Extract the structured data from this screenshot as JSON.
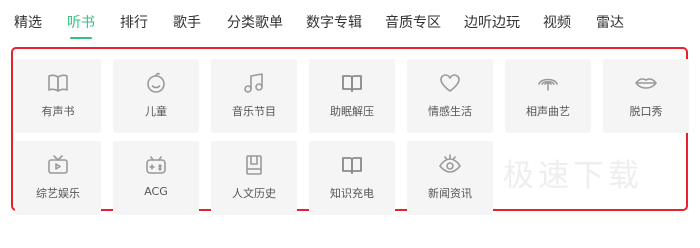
{
  "tabs": [
    {
      "label": "精选"
    },
    {
      "label": "听书",
      "active": true
    },
    {
      "label": "排行"
    },
    {
      "label": "歌手"
    },
    {
      "label": "分类歌单"
    },
    {
      "label": "数字专辑"
    },
    {
      "label": "音质专区"
    },
    {
      "label": "边听边玩"
    },
    {
      "label": "视频"
    },
    {
      "label": "雷达"
    }
  ],
  "categories": [
    {
      "label": "有声书",
      "icon": "open-book-icon"
    },
    {
      "label": "儿童",
      "icon": "baby-face-icon"
    },
    {
      "label": "音乐节目",
      "icon": "music-note-icon"
    },
    {
      "label": "助眠解压",
      "icon": "book-icon"
    },
    {
      "label": "情感生活",
      "icon": "heart-icon"
    },
    {
      "label": "相声曲艺",
      "icon": "wave-fan-icon"
    },
    {
      "label": "脱口秀",
      "icon": "lips-icon"
    },
    {
      "label": "综艺娱乐",
      "icon": "tv-icon"
    },
    {
      "label": "ACG",
      "icon": "gamepad-icon"
    },
    {
      "label": "人文历史",
      "icon": "document-icon"
    },
    {
      "label": "知识充电",
      "icon": "book-icon"
    },
    {
      "label": "新闻资讯",
      "icon": "eye-icon"
    }
  ],
  "watermark": "极速下载",
  "colors": {
    "accent": "#31c27c",
    "highlight_border": "#e8212f",
    "tile": "#f5f5f5",
    "icon": "#999999"
  }
}
